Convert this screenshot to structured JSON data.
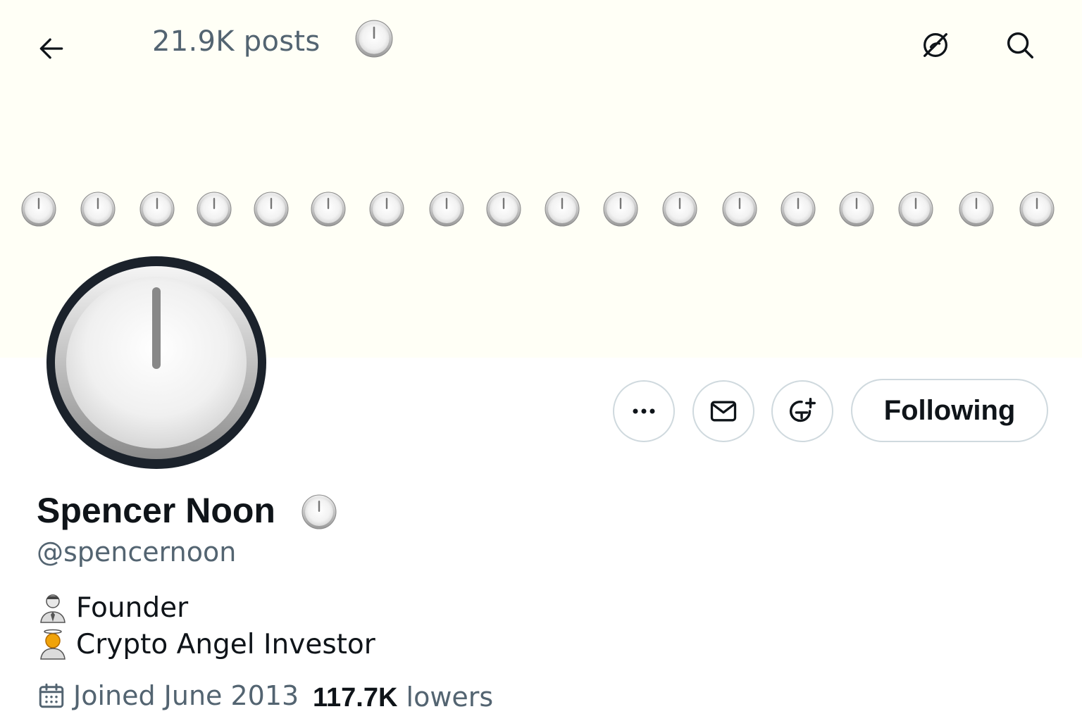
{
  "header": {
    "posts_count": "21.9K posts"
  },
  "banner": {
    "clock_count": 18
  },
  "profile": {
    "display_name": "Spencer Noon",
    "handle": "@spencernoon",
    "bio": [
      {
        "icon": "businessman-emoji-icon",
        "text": "Founder"
      },
      {
        "icon": "angel-emoji-icon",
        "text": "Crypto Angel Investor"
      }
    ],
    "joined": "Joined June 2013",
    "followers_count": "117.7K",
    "followers_label": "lowers"
  },
  "actions": {
    "more_icon": "more-horizontal-icon",
    "message_icon": "mail-icon",
    "subscribe_icon": "add-notification-icon",
    "following_label": "Following"
  },
  "icons": {
    "back": "arrow-left-icon",
    "hide": "eye-off-icon",
    "search": "search-icon",
    "clock": "clock-twelve-icon",
    "calendar": "calendar-icon"
  },
  "colors": {
    "banner_bg": "#fffff6",
    "secondary_text": "#536471",
    "primary_text": "#0f1419",
    "border": "#cfd9de"
  }
}
